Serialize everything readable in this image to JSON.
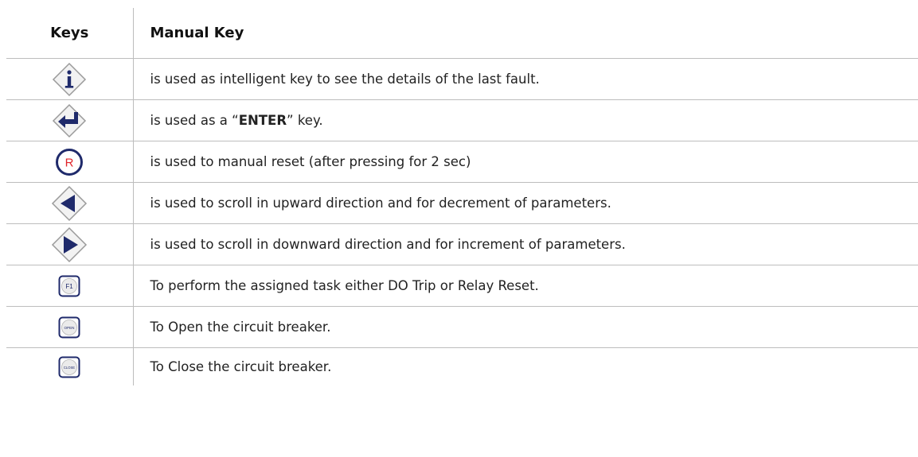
{
  "table": {
    "headers": {
      "keys": "Keys",
      "manual_key": "Manual Key"
    },
    "rows": [
      {
        "icon": "info-key-icon",
        "desc": "is used as intelligent key to see the details of the last fault."
      },
      {
        "icon": "enter-key-icon",
        "desc_pre": "is used as a “",
        "desc_strong": "ENTER",
        "desc_post": "” key."
      },
      {
        "icon": "reset-key-icon",
        "key_label": "R",
        "desc": "is used to manual reset (after pressing for 2 sec)"
      },
      {
        "icon": "left-arrow-key-icon",
        "desc": "is used to scroll in upward direction and for decrement of parameters."
      },
      {
        "icon": "right-arrow-key-icon",
        "desc": "is used to scroll in downward direction and for increment of parameters."
      },
      {
        "icon": "f1-key-icon",
        "key_label": "F1",
        "desc": "To perform the assigned task either DO Trip or Relay Reset."
      },
      {
        "icon": "open-key-icon",
        "key_label": "OPEN",
        "desc": "To Open the circuit breaker."
      },
      {
        "icon": "close-key-icon",
        "key_label": "CLOSE",
        "desc": " To Close the circuit breaker."
      }
    ]
  },
  "colors": {
    "navy": "#1f2a6b",
    "red": "#e0242a",
    "key_face": "#ebebeb",
    "border": "#bdbdbd"
  }
}
